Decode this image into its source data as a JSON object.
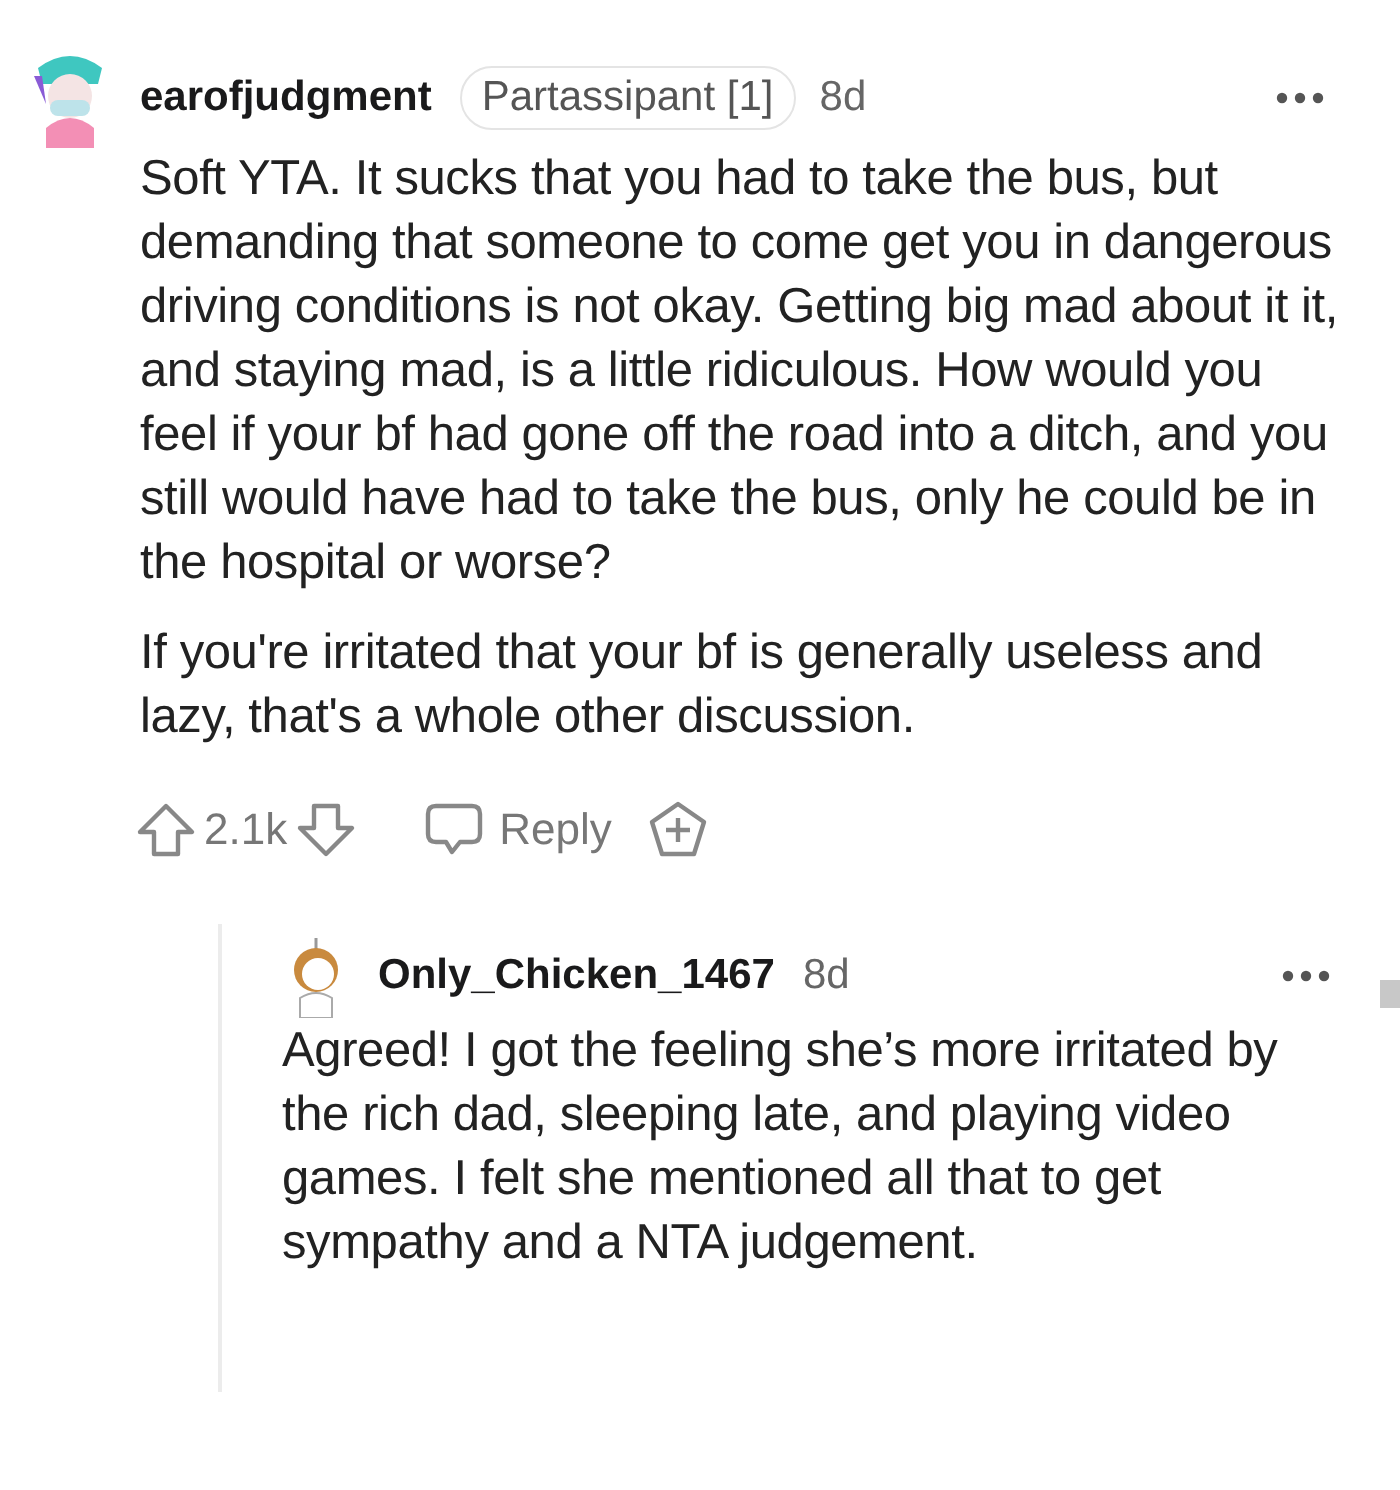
{
  "comment": {
    "author": "earofjudgment",
    "flair": "Partassipant [1]",
    "age": "8d",
    "paragraphs": [
      "Soft YTA. It sucks that you had to take the bus, but demanding that someone to come get you in dangerous driving conditions is not okay. Getting big mad about it it, and staying mad, is a little ridiculous. How would you feel if your bf had gone off the road into a ditch, and you still would have had to take the bus, only he could be in the hospital or worse?",
      "If you're irritated that your bf is generally useless and lazy, that's a whole other discussion."
    ],
    "votes": "2.1k",
    "reply_label": "Reply"
  },
  "replies": [
    {
      "author": "Only_Chicken_1467",
      "age": "8d",
      "paragraphs": [
        "Agreed! I got the feeling she’s more irritated by the rich dad, sleeping late, and playing video games. I felt she mentioned all that to get sympathy and a NTA judgement."
      ]
    }
  ]
}
